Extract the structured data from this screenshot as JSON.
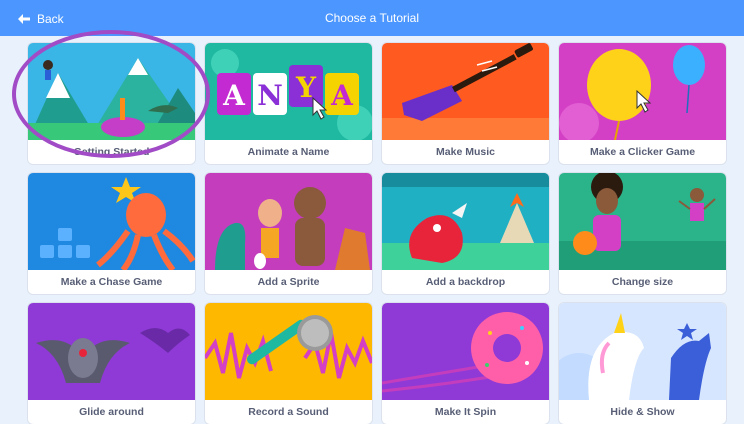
{
  "header": {
    "back_label": "Back",
    "title": "Choose a Tutorial"
  },
  "tutorials": [
    {
      "label": "Getting Started"
    },
    {
      "label": "Animate a Name",
      "thumb_text": "ANYA"
    },
    {
      "label": "Make Music"
    },
    {
      "label": "Make a Clicker Game"
    },
    {
      "label": "Make a Chase Game"
    },
    {
      "label": "Add a Sprite"
    },
    {
      "label": "Add a backdrop"
    },
    {
      "label": "Change size"
    },
    {
      "label": "Glide around"
    },
    {
      "label": "Record a Sound"
    },
    {
      "label": "Make It Spin"
    },
    {
      "label": "Hide & Show"
    }
  ],
  "colors": {
    "header": "#4c97ff",
    "page_bg": "#e9f1fc",
    "label_text": "#575e75",
    "annotation_circle": "#a14cc6"
  }
}
